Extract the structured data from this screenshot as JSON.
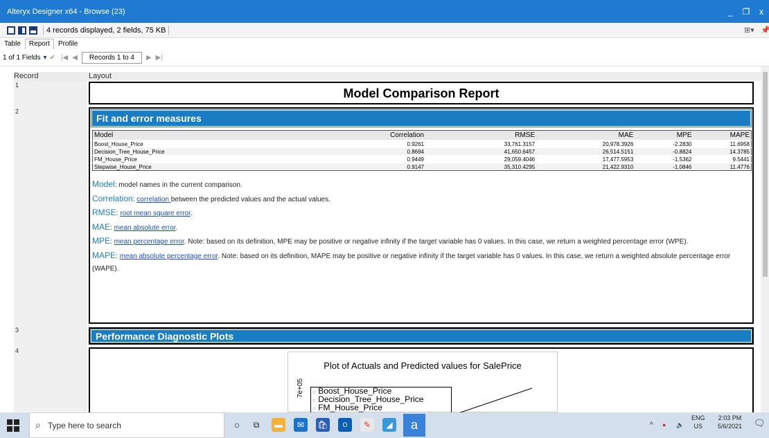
{
  "window": {
    "title": "Alteryx Designer x64 - Browse (23)",
    "minimize": "_",
    "restore": "❐",
    "close": "x"
  },
  "toolbar": {
    "info": "4 records displayed, 2 fields, 75 KB"
  },
  "tabs": [
    {
      "label": "Table"
    },
    {
      "label": "Report"
    },
    {
      "label": "Profile"
    }
  ],
  "nav": {
    "fields": "1 of 1 Fields",
    "records": "Records 1 to 4"
  },
  "grid": {
    "col_record": "Record",
    "col_layout": "Layout",
    "rows": [
      "1",
      "2",
      "3",
      "4"
    ]
  },
  "report": {
    "title": "Model Comparison Report",
    "section1": "Fit and error measures",
    "section2": "Performance Diagnostic Plots",
    "table": {
      "headers": [
        "Model",
        "Correlation",
        "RMSE",
        "MAE",
        "MPE",
        "MAPE"
      ],
      "rows": [
        [
          "Boost_House_Price",
          "0.9261",
          "33,761.3157",
          "20,978.3926",
          "-2.2830",
          "11.6958"
        ],
        [
          "Decision_Tree_House_Price",
          "0.8694",
          "41,650.6457",
          "26,514.5151",
          "-0.8824",
          "14.3785"
        ],
        [
          "FM_House_Price",
          "0.9449",
          "29,059.4046",
          "17,477.5953",
          "-1.5362",
          "9.5441"
        ],
        [
          "Stepwise_House_Price",
          "0.9147",
          "35,310.4295",
          "21,422.9310",
          "-1.0846",
          "11.4776"
        ]
      ]
    },
    "desc": {
      "model_term": "Model",
      "model_text": ": model names in the current comparison.",
      "corr_term": "Correlation",
      "corr_sep": ": ",
      "corr_link": "correlation ",
      "corr_text": "between the predicted values and the actual values.",
      "rmse_term": "RMSE",
      "rmse_sep": ": ",
      "rmse_link": "root mean square error",
      "rmse_end": ".",
      "mae_term": "MAE",
      "mae_sep": ": ",
      "mae_link": "mean absolute error",
      "mae_end": ".",
      "mpe_term": "MPE",
      "mpe_sep": ": ",
      "mpe_link": "mean percentage error",
      "mpe_text": ". Note: based on its definition, MPE may be positive or negative infinity if the target variable has 0 values. In this case, we return a weighted percentage error (WPE).",
      "mape_term": "MAPE",
      "mape_sep": ": ",
      "mape_link": "mean absolute percentage error",
      "mape_text": ". Note: based on its definition, MAPE may be positive or negative infinity if the target variable has 0 values. In this case, we return a weighted absolute percentage error (WAPE)."
    },
    "plot": {
      "title": "Plot of Actuals and Predicted values for SalePrice",
      "ytick": "7e+05",
      "legend": [
        "Boost_House_Price",
        "Decision_Tree_House_Price",
        "FM_House_Price"
      ]
    }
  },
  "taskbar": {
    "search_placeholder": "Type here to search",
    "lang": "ENG",
    "region": "US",
    "time": "2:03 PM",
    "date": "5/6/2021"
  }
}
